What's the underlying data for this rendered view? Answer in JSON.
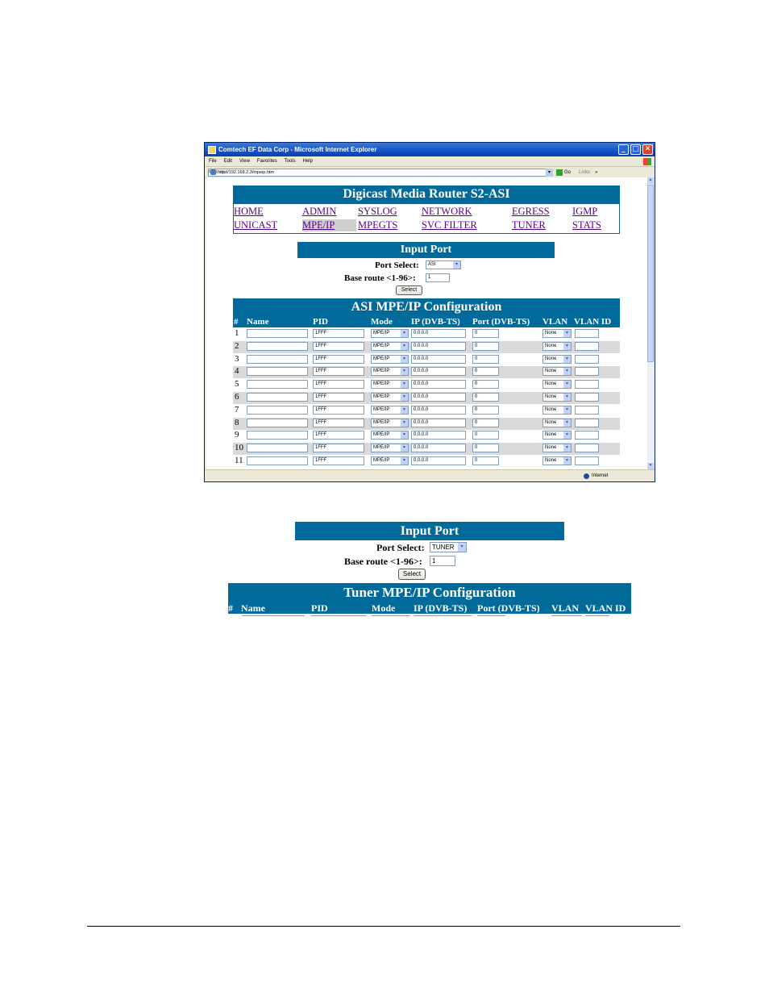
{
  "window": {
    "title": "Comtech EF Data Corp - Microsoft Internet Explorer",
    "menu": [
      "File",
      "Edit",
      "View",
      "Favorites",
      "Tools",
      "Help"
    ],
    "address_label": "Address",
    "url": "http://192.168.2.3/mpeip.htm",
    "go_label": "Go",
    "links_label": "Links",
    "chevrons": "»",
    "status_zone": "Internet",
    "btn_min": "_",
    "btn_max": "□",
    "btn_close": "✕",
    "scroll_up": "▲",
    "scroll_down": "▼"
  },
  "app": {
    "title": "Digicast Media Router S2-ASI",
    "nav": {
      "home": "HOME",
      "admin": "ADMIN",
      "syslog": "SYSLOG",
      "network": "NETWORK",
      "egress": "EGRESS",
      "igmp": "IGMP",
      "unicast": "UNICAST",
      "mpeip": "MPE/IP",
      "mpegts": "MPEGTS",
      "svcfilter": "SVC FILTER",
      "tuner": "TUNER",
      "stats": "STATS"
    },
    "input_port": {
      "title": "Input Port",
      "port_select_label": "Port Select:",
      "port_select_value": "ASI",
      "base_route_label": "Base route <1-96>:",
      "base_route_value": "1",
      "select_button": "Select"
    },
    "table": {
      "title": "ASI MPE/IP Configuration",
      "headers": {
        "num": "#",
        "name": "Name",
        "pid": "PID",
        "mode": "Mode",
        "ip": "IP (DVB-TS)",
        "port": "Port (DVB-TS)",
        "vlan": "VLAN",
        "vlanid": "VLAN ID"
      },
      "rows": [
        {
          "num": "1",
          "name": "",
          "pid": "1FFF",
          "mode": "MPE/IP",
          "ip": "0.0.0.0",
          "port": "0",
          "vlan": "None",
          "vlanid": ""
        },
        {
          "num": "2",
          "name": "",
          "pid": "1FFF",
          "mode": "MPE/IP",
          "ip": "0.0.0.0",
          "port": "0",
          "vlan": "None",
          "vlanid": ""
        },
        {
          "num": "3",
          "name": "",
          "pid": "1FFF",
          "mode": "MPE/IP",
          "ip": "0.0.0.0",
          "port": "0",
          "vlan": "None",
          "vlanid": ""
        },
        {
          "num": "4",
          "name": "",
          "pid": "1FFF",
          "mode": "MPE/IP",
          "ip": "0.0.0.0",
          "port": "0",
          "vlan": "None",
          "vlanid": ""
        },
        {
          "num": "5",
          "name": "",
          "pid": "1FFF",
          "mode": "MPE/IP",
          "ip": "0.0.0.0",
          "port": "0",
          "vlan": "None",
          "vlanid": ""
        },
        {
          "num": "6",
          "name": "",
          "pid": "1FFF",
          "mode": "MPE/IP",
          "ip": "0.0.0.0",
          "port": "0",
          "vlan": "None",
          "vlanid": ""
        },
        {
          "num": "7",
          "name": "",
          "pid": "1FFF",
          "mode": "MPE/IP",
          "ip": "0.0.0.0",
          "port": "0",
          "vlan": "None",
          "vlanid": ""
        },
        {
          "num": "8",
          "name": "",
          "pid": "1FFF",
          "mode": "MPE/IP",
          "ip": "0.0.0.0",
          "port": "0",
          "vlan": "None",
          "vlanid": ""
        },
        {
          "num": "9",
          "name": "",
          "pid": "1FFF",
          "mode": "MPE/IP",
          "ip": "0.0.0.0",
          "port": "0",
          "vlan": "None",
          "vlanid": ""
        },
        {
          "num": "10",
          "name": "",
          "pid": "1FFF",
          "mode": "MPE/IP",
          "ip": "0.0.0.0",
          "port": "0",
          "vlan": "None",
          "vlanid": ""
        },
        {
          "num": "11",
          "name": "",
          "pid": "1FFF",
          "mode": "MPE/IP",
          "ip": "0.0.0.0",
          "port": "0",
          "vlan": "None",
          "vlanid": ""
        }
      ]
    }
  },
  "app2": {
    "input_port": {
      "title": "Input Port",
      "port_select_label": "Port Select:",
      "port_select_value": "TUNER",
      "base_route_label": "Base route <1-96>:",
      "base_route_value": "1",
      "select_button": "Select"
    },
    "table": {
      "title": "Tuner MPE/IP Configuration",
      "headers": {
        "num": "#",
        "name": "Name",
        "pid": "PID",
        "mode": "Mode",
        "ip": "IP (DVB-TS)",
        "port": "Port (DVB-TS)",
        "vlan": "VLAN",
        "vlanid": "VLAN ID"
      }
    }
  },
  "colors": {
    "banner": "#006a9a",
    "link": "#5a0082",
    "row_alt": "#d9d9d9"
  },
  "icons": [
    "ie-icon",
    "minimize-icon",
    "maximize-icon",
    "close-icon",
    "windows-flag-icon",
    "page-icon",
    "go-arrow-icon",
    "internet-zone-icon",
    "chevron-down-icon"
  ]
}
